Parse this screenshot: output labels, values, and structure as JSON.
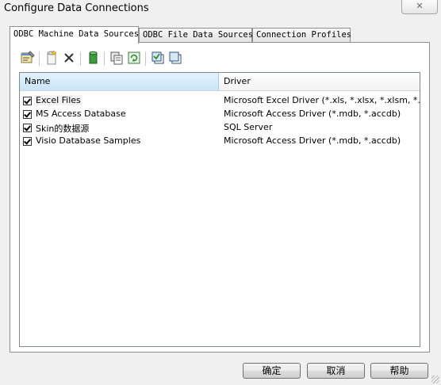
{
  "window": {
    "title": "Configure Data Connections",
    "close_glyph": "✕"
  },
  "tabs": [
    {
      "label": "ODBC Machine Data Sources",
      "active": true
    },
    {
      "label": "ODBC File Data Sources",
      "active": false
    },
    {
      "label": "Connection Profiles",
      "active": false
    }
  ],
  "toolbar": {
    "buttons": [
      "properties-icon",
      "new-icon",
      "delete-icon",
      "database-icon",
      "copy-icon",
      "refresh-icon",
      "select-all-icon",
      "deselect-all-icon"
    ]
  },
  "list": {
    "columns": {
      "name": "Name",
      "driver": "Driver"
    },
    "rows": [
      {
        "name": "Excel Files",
        "driver": "Microsoft Excel Driver (*.xls, *.xlsx, *.xlsm, *.xlsb)",
        "checked": true
      },
      {
        "name": "MS Access Database",
        "driver": "Microsoft Access Driver (*.mdb, *.accdb)",
        "checked": true
      },
      {
        "name": "Skin的数据源",
        "driver": "SQL Server",
        "checked": true
      },
      {
        "name": "Visio Database Samples",
        "driver": "Microsoft Access Driver (*.mdb, *.accdb)",
        "checked": true
      }
    ]
  },
  "buttons": {
    "ok": "确定",
    "cancel": "取消",
    "help": "帮助"
  },
  "colors": {
    "header_selected": "#c8e5f8",
    "background": "#f0f0f0"
  }
}
